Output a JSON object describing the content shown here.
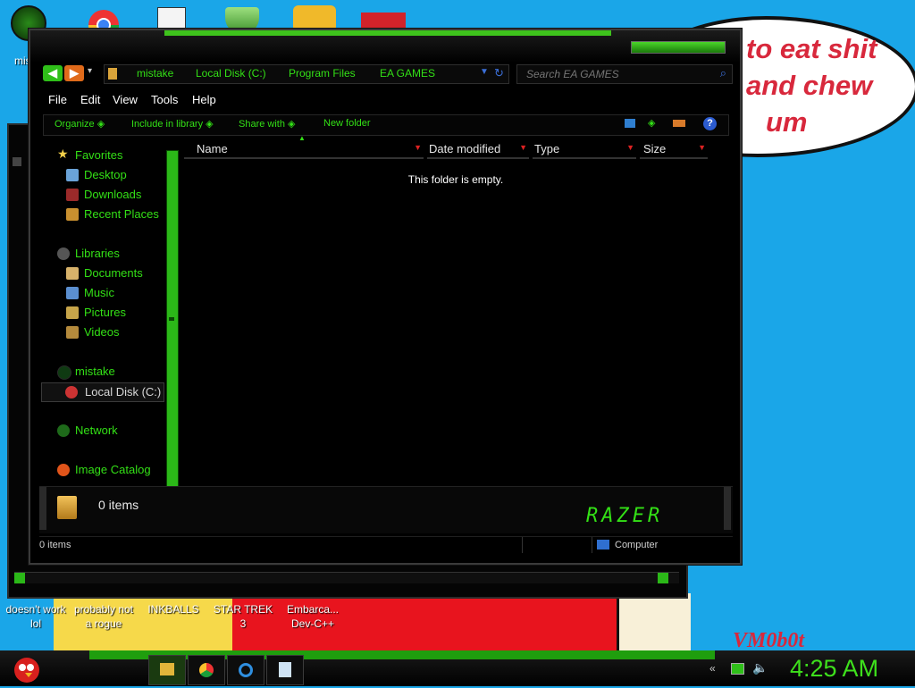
{
  "desktop": {
    "icons_top": [
      {
        "name": "mistake-icon",
        "label": "mis"
      },
      {
        "name": "chrome-icon",
        "label": ""
      },
      {
        "name": "solitaire-icon",
        "label": ""
      },
      {
        "name": "shield-icon",
        "label": ""
      },
      {
        "name": "angry-birds-icon",
        "label": ""
      },
      {
        "name": "w-app-icon",
        "label": ""
      }
    ],
    "icons_bottom": [
      {
        "name": "doesnt-work-icon",
        "label_line1": "doesn't work",
        "label_line2": "lol"
      },
      {
        "name": "probably-not-icon",
        "label_line1": "probably not",
        "label_line2": "a rogue"
      },
      {
        "name": "inkballs-icon",
        "label_line1": "INKBALLS",
        "label_line2": ""
      },
      {
        "name": "star-trek-icon",
        "label_line1": "STAR TREK",
        "label_line2": "3"
      },
      {
        "name": "devcpp-icon",
        "label_line1": "Embarca...",
        "label_line2": "Dev-C++"
      }
    ],
    "bubble_lines": [
      "to eat shit",
      "and chew",
      "um"
    ],
    "signature": "VM0b0t"
  },
  "window": {
    "breadcrumbs": [
      "mistake",
      "Local Disk (C:)",
      "Program Files",
      "EA GAMES"
    ],
    "search_placeholder": "Search EA GAMES",
    "menu": [
      "File",
      "Edit",
      "View",
      "Tools",
      "Help"
    ],
    "commands": [
      "Organize",
      "Include in library",
      "Share with",
      "New folder"
    ],
    "nav": {
      "favorites": {
        "label": "Favorites",
        "items": [
          "Desktop",
          "Downloads",
          "Recent Places"
        ]
      },
      "libraries": {
        "label": "Libraries",
        "items": [
          "Documents",
          "Music",
          "Pictures",
          "Videos"
        ]
      },
      "computer": {
        "label": "mistake",
        "items": [
          "Local Disk (C:)"
        ]
      },
      "network": {
        "label": "Network"
      },
      "image_catalog": {
        "label": "Image Catalog"
      }
    },
    "columns": [
      "Name",
      "Date modified",
      "Type",
      "Size"
    ],
    "empty_message": "This folder is empty.",
    "details_count": "0 items",
    "status_count": "0 items",
    "status_location": "Computer",
    "logo_text": "RAZER"
  },
  "taskbar": {
    "clock": "4:25 AM",
    "apps": [
      "explorer-button",
      "chrome-button",
      "ie-button",
      "notepad-button"
    ]
  },
  "colors": {
    "accent": "#33e016",
    "desktop": "#1aa6e8",
    "window": "#000000"
  }
}
